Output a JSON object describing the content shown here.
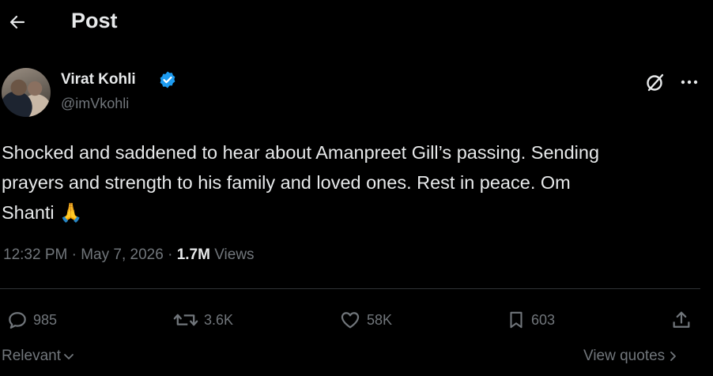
{
  "header": {
    "title": "Post"
  },
  "author": {
    "name": "Virat Kohli",
    "handle": "@imVkohli"
  },
  "tweet": {
    "line1": "Shocked and saddened to hear about Amanpreet Gill’s passing. Sending",
    "line2": "prayers and strength to his family and loved ones. Rest in peace. Om",
    "line3": "Shanti",
    "emoji": "🙏"
  },
  "meta": {
    "time": "12:32 PM",
    "separator": "·",
    "date": "May 7, 2026",
    "views_count": "1.7M",
    "views_label": "Views"
  },
  "actions": {
    "replies": "985",
    "reposts": "3.6K",
    "likes": "58K",
    "bookmarks": "603"
  },
  "footer": {
    "sort_label": "Relevant",
    "view_quotes": "View quotes"
  },
  "colors": {
    "verified": "#1d9bf0",
    "muted": "#71767b",
    "text": "#e7e9ea",
    "background": "#000000"
  },
  "icons": [
    "back-arrow-icon",
    "verified-badge-icon",
    "grok-icon",
    "more-icon",
    "reply-icon",
    "repost-icon",
    "like-icon",
    "bookmark-icon",
    "share-icon",
    "chevron-down-icon",
    "chevron-right-icon"
  ]
}
